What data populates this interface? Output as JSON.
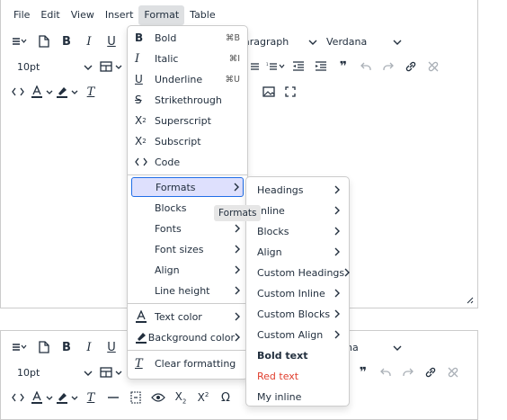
{
  "menubar": [
    "File",
    "Edit",
    "View",
    "Insert",
    "Format",
    "Table"
  ],
  "toolbar": {
    "block_format": "Paragraph",
    "block_format_partial": "aragraph",
    "font_family": "Verdana",
    "font_family_partial": "na",
    "font_size": "10pt"
  },
  "format_menu": {
    "items": [
      {
        "label": "Bold",
        "icon": "bold-icon",
        "shortcut": "⌘B"
      },
      {
        "label": "Italic",
        "icon": "italic-icon",
        "shortcut": "⌘I"
      },
      {
        "label": "Underline",
        "icon": "underline-icon",
        "shortcut": "⌘U"
      },
      {
        "label": "Strikethrough",
        "icon": "strikethrough-icon",
        "shortcut": ""
      },
      {
        "label": "Superscript",
        "icon": "superscript-icon",
        "shortcut": ""
      },
      {
        "label": "Subscript",
        "icon": "subscript-icon",
        "shortcut": ""
      },
      {
        "label": "Code",
        "icon": "code-icon",
        "shortcut": ""
      },
      {
        "label": "Formats",
        "icon": "",
        "submenu": true,
        "highlighted": true
      },
      {
        "label": "Blocks",
        "icon": "",
        "submenu": true
      },
      {
        "label": "Fonts",
        "icon": "",
        "submenu": true
      },
      {
        "label": "Font sizes",
        "icon": "",
        "submenu": true
      },
      {
        "label": "Align",
        "icon": "",
        "submenu": true
      },
      {
        "label": "Line height",
        "icon": "",
        "submenu": true
      },
      {
        "label": "Text color",
        "icon": "text-color-icon",
        "submenu": true
      },
      {
        "label": "Background color",
        "icon": "highlight-color-icon",
        "submenu": true
      },
      {
        "label": "Clear formatting",
        "icon": "clear-formatting-icon",
        "submenu": false
      }
    ]
  },
  "formats_submenu": {
    "items": [
      {
        "label": "Headings",
        "submenu": true
      },
      {
        "label": "Inline",
        "submenu": true
      },
      {
        "label": "Blocks",
        "submenu": true
      },
      {
        "label": "Align",
        "submenu": true
      },
      {
        "label": "Custom Headings",
        "submenu": true
      },
      {
        "label": "Custom Inline",
        "submenu": true
      },
      {
        "label": "Custom Blocks",
        "submenu": true
      },
      {
        "label": "Custom Align",
        "submenu": true
      },
      {
        "label": "Bold text",
        "submenu": false,
        "style": "bold"
      },
      {
        "label": "Red text",
        "submenu": false,
        "style": "red"
      },
      {
        "label": "My inline",
        "submenu": false,
        "style": "plain"
      }
    ],
    "inline_partial": "nline"
  },
  "tooltip": "Formats",
  "colors": {
    "red_text": "#e03e2d",
    "highlight_bg": "#dee0fd",
    "highlight_border": "#206ee7"
  }
}
